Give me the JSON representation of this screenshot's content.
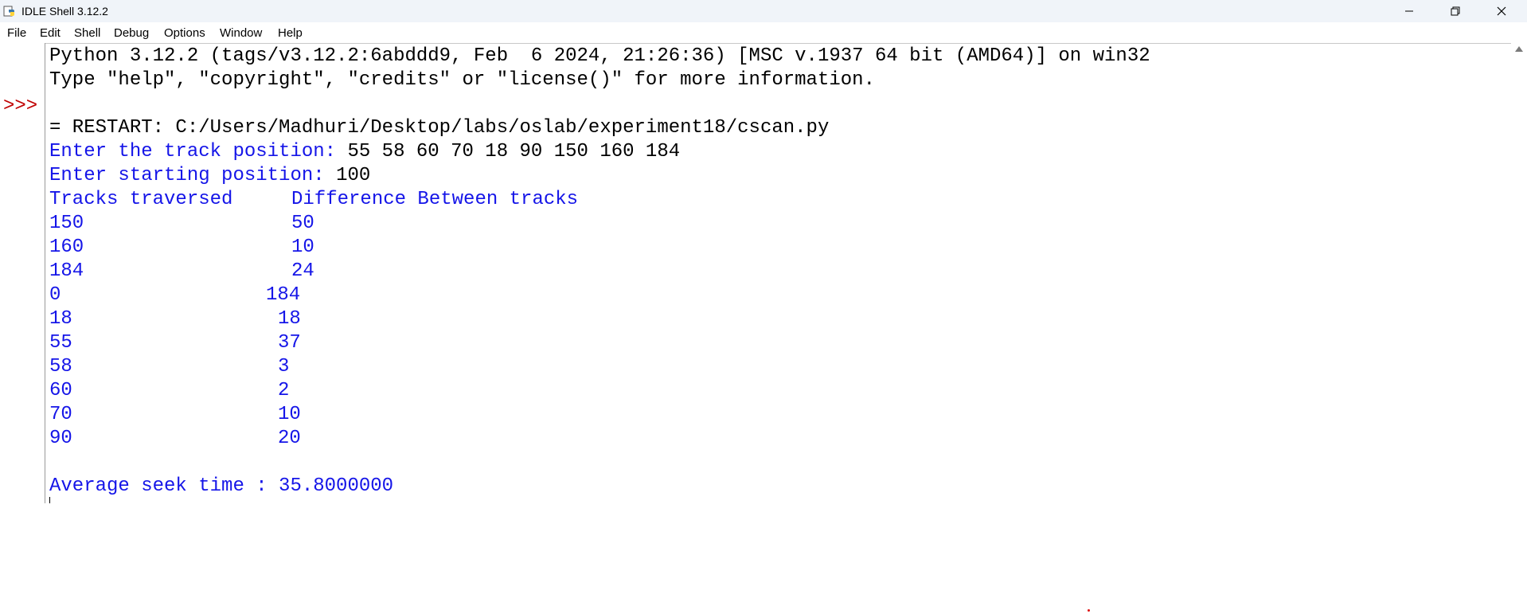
{
  "window": {
    "title": "IDLE Shell 3.12.2",
    "icon": "python-idle-icon"
  },
  "menu": [
    "File",
    "Edit",
    "Shell",
    "Debug",
    "Options",
    "Window",
    "Help"
  ],
  "shell": {
    "prompt": ">>>",
    "banner_line1": "Python 3.12.2 (tags/v3.12.2:6abddd9, Feb  6 2024, 21:26:36) [MSC v.1937 64 bit (AMD64)] on win32",
    "banner_line2": "Type \"help\", \"copyright\", \"credits\" or \"license()\" for more information.",
    "restart_line": "= RESTART: C:/Users/Madhuri/Desktop/labs/oslab/experiment18/cscan.py",
    "track_prompt": "Enter the track position: ",
    "track_input": "55 58 60 70 18 90 150 160 184",
    "start_prompt": "Enter starting position: ",
    "start_input": "100",
    "table_header_col1": "Tracks traversed",
    "table_header_col2": "Difference Between tracks",
    "rows": [
      {
        "track": "150",
        "diff": "50"
      },
      {
        "track": "160",
        "diff": "10"
      },
      {
        "track": "184",
        "diff": "24"
      },
      {
        "track": "0",
        "diff": "184"
      },
      {
        "track": "18",
        "diff": "18"
      },
      {
        "track": "55",
        "diff": "37"
      },
      {
        "track": "58",
        "diff": "3"
      },
      {
        "track": "60",
        "diff": "2"
      },
      {
        "track": "70",
        "diff": "10"
      },
      {
        "track": "90",
        "diff": "20"
      }
    ],
    "average_line": "Average seek time : 35.8000000"
  },
  "colors": {
    "output": "#1515e8",
    "prompt": "#c00000",
    "text": "#000000"
  }
}
